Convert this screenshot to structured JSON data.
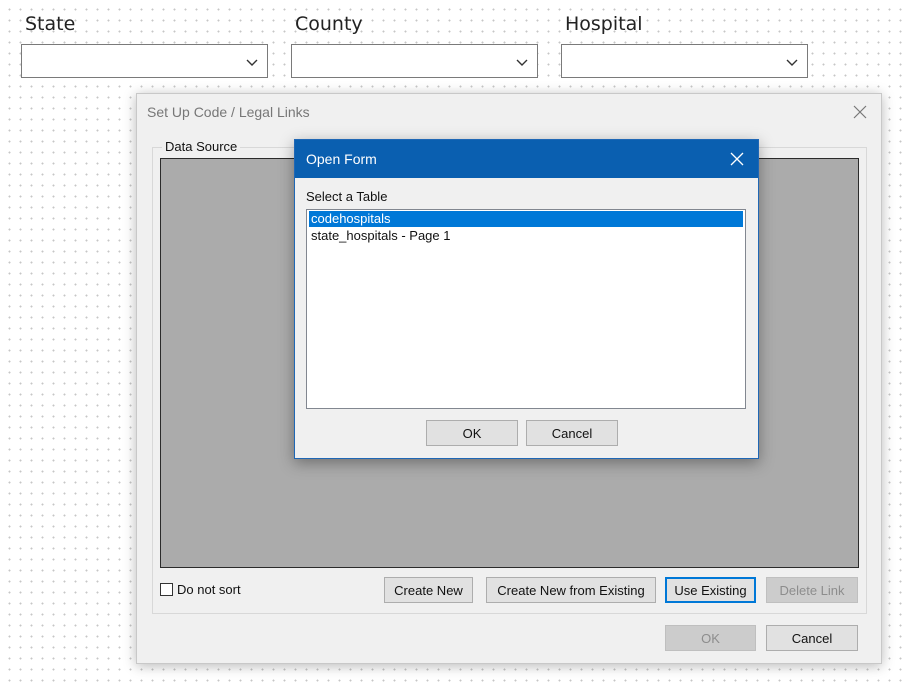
{
  "filters": {
    "state": {
      "label": "State",
      "value": ""
    },
    "county": {
      "label": "County",
      "value": ""
    },
    "hospital": {
      "label": "Hospital",
      "value": ""
    }
  },
  "setup_dialog": {
    "title": "Set Up Code / Legal Links",
    "group_label": "Data Source",
    "do_not_sort_label": "Do not sort",
    "do_not_sort_checked": false,
    "buttons": {
      "create_new": "Create New",
      "create_new_from_existing": "Create New from Existing",
      "use_existing": "Use Existing",
      "delete_link": "Delete Link",
      "ok": "OK",
      "cancel": "Cancel"
    }
  },
  "open_form": {
    "title": "Open Form",
    "select_label": "Select a Table",
    "items": [
      {
        "label": "codehospitals",
        "selected": true
      },
      {
        "label": "state_hospitals - Page 1",
        "selected": false
      }
    ],
    "ok_label": "OK",
    "cancel_label": "Cancel"
  },
  "colors": {
    "accent": "#0078d7",
    "modal_titlebar": "#0a5fb0",
    "grid_background": "#ababab"
  },
  "icons": {
    "dropdown": "chevron-down-icon",
    "close": "close-icon"
  }
}
